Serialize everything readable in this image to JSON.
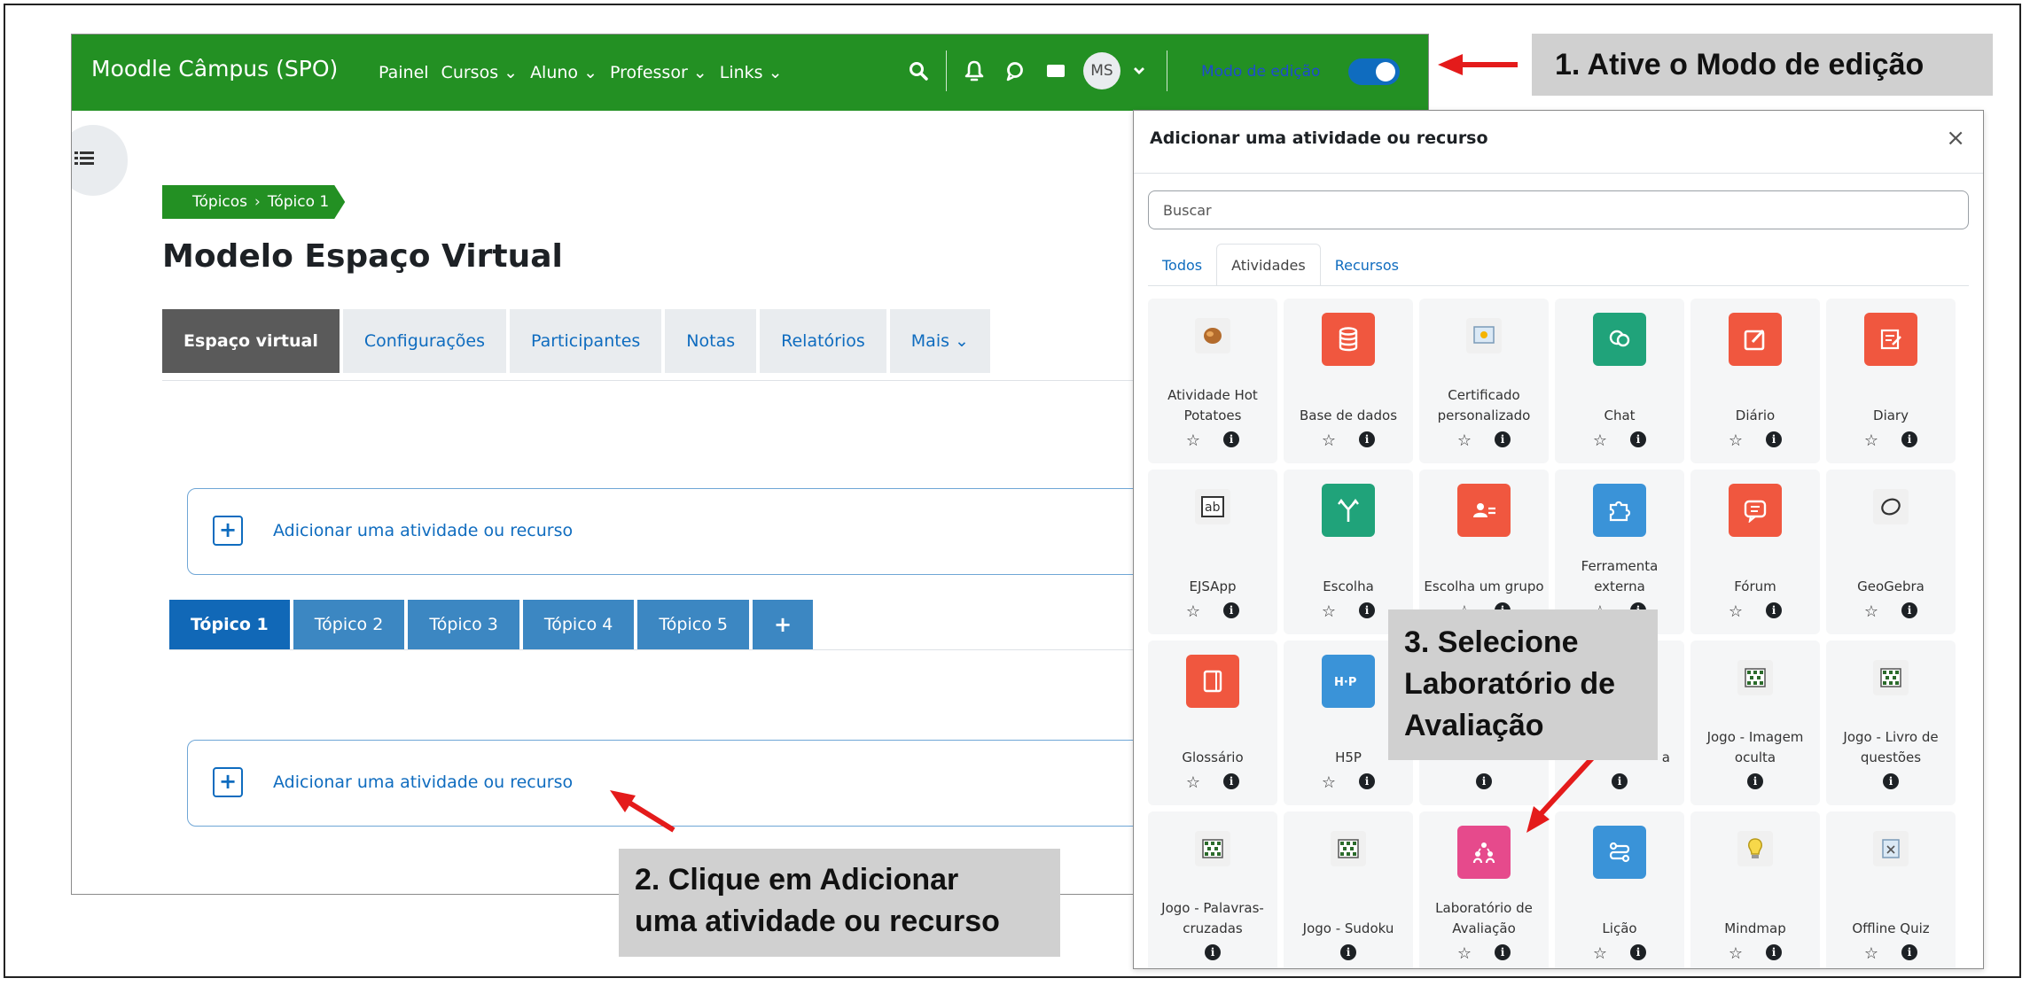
{
  "navbar": {
    "brand": "Moodle Câmpus (SPO)",
    "menu": [
      "Painel",
      "Cursos ⌄",
      "Aluno ⌄",
      "Professor ⌄",
      "Links ⌄"
    ],
    "avatar": "MS",
    "edit_mode_label": "Modo de edição",
    "edit_mode_on": true
  },
  "breadcrumb": {
    "root": "Tópicos",
    "current": "Tópico 1"
  },
  "page_title": "Modelo Espaço Virtual",
  "course_tabs": [
    {
      "label": "Espaço virtual",
      "active": true
    },
    {
      "label": "Configurações",
      "active": false
    },
    {
      "label": "Participantes",
      "active": false
    },
    {
      "label": "Notas",
      "active": false
    },
    {
      "label": "Relatórios",
      "active": false
    },
    {
      "label": "Mais ⌄",
      "active": false
    }
  ],
  "add_activity_label": "Adicionar uma atividade ou recurso",
  "topic_tabs": [
    "Tópico 1",
    "Tópico 2",
    "Tópico 3",
    "Tópico 4",
    "Tópico 5",
    "+"
  ],
  "modal": {
    "title": "Adicionar uma atividade ou recurso",
    "close": "×",
    "search_placeholder": "Buscar",
    "tabs": [
      {
        "label": "Todos",
        "active": false
      },
      {
        "label": "Atividades",
        "active": true
      },
      {
        "label": "Recursos",
        "active": false
      }
    ],
    "items": [
      {
        "name": "Atividade Hot Potatoes",
        "icon": "hot-potatoes-icon",
        "color": "#f0f0f0",
        "star": true,
        "info": true
      },
      {
        "name": "Base de dados",
        "icon": "database-icon",
        "color": "#f0573f",
        "star": true,
        "info": true
      },
      {
        "name": "Certificado personalizado",
        "icon": "certificate-icon",
        "color": "#f0f0f0",
        "star": true,
        "info": true
      },
      {
        "name": "Chat",
        "icon": "chat-icon",
        "color": "#20a37a",
        "star": true,
        "info": true
      },
      {
        "name": "Diário",
        "icon": "journal-icon",
        "color": "#f0573f",
        "star": true,
        "info": true
      },
      {
        "name": "Diary",
        "icon": "diary-icon",
        "color": "#f0573f",
        "star": true,
        "info": true
      },
      {
        "name": "EJSApp",
        "icon": "ejsapp-lab-icon",
        "color": "#f0f0f0",
        "star": true,
        "info": true
      },
      {
        "name": "Escolha",
        "icon": "choice-icon",
        "color": "#20a37a",
        "star": true,
        "info": true
      },
      {
        "name": "Escolha um grupo",
        "icon": "group-choice-icon",
        "color": "#f0573f",
        "star": true,
        "info": true
      },
      {
        "name": "Ferramenta externa",
        "icon": "external-tool-icon",
        "color": "#3a93d8",
        "star": true,
        "info": true
      },
      {
        "name": "Fórum",
        "icon": "forum-icon",
        "color": "#f0573f",
        "star": true,
        "info": true
      },
      {
        "name": "GeoGebra",
        "icon": "geogebra-icon",
        "color": "#f0f0f0",
        "star": true,
        "info": true
      },
      {
        "name": "Glossário",
        "icon": "glossary-icon",
        "color": "#f0573f",
        "star": true,
        "info": true
      },
      {
        "name": "H5P",
        "icon": "h5p-icon",
        "color": "#3a93d8",
        "star": true,
        "info": true
      },
      {
        "name": "",
        "icon": "hidden-icon",
        "color": "#f5f6f7",
        "star": false,
        "info": true
      },
      {
        "name": "a",
        "icon": "hidden-icon",
        "color": "#f5f6f7",
        "star": false,
        "info": true
      },
      {
        "name": "Jogo - Imagem oculta",
        "icon": "game-icon",
        "color": "#f0f0f0",
        "star": false,
        "info": true
      },
      {
        "name": "Jogo - Livro de questões",
        "icon": "game-icon",
        "color": "#f0f0f0",
        "star": false,
        "info": true
      },
      {
        "name": "Jogo - Palavras-cruzadas",
        "icon": "game-icon",
        "color": "#f0f0f0",
        "star": false,
        "info": true
      },
      {
        "name": "Jogo - Sudoku",
        "icon": "game-icon",
        "color": "#f0f0f0",
        "star": false,
        "info": true
      },
      {
        "name": "Laboratório de Avaliação",
        "icon": "workshop-icon",
        "color": "#e64a8c",
        "star": true,
        "info": true
      },
      {
        "name": "Lição",
        "icon": "lesson-icon",
        "color": "#3a93d8",
        "star": true,
        "info": true
      },
      {
        "name": "Mindmap",
        "icon": "mindmap-icon",
        "color": "#f0f0f0",
        "star": true,
        "info": true
      },
      {
        "name": "Offline Quiz",
        "icon": "offline-quiz-icon",
        "color": "#f0f0f0",
        "star": true,
        "info": true
      }
    ]
  },
  "callouts": {
    "step1": "1. Ative o Modo de edição",
    "step2_line1": "2. Clique em Adicionar",
    "step2_line2": "uma atividade ou recurso",
    "step3_line1": "3. Selecione",
    "step3_line2": "Laboratório de",
    "step3_line3": "Avaliação"
  },
  "colors": {
    "navbar": "#239023",
    "primary": "#0f6cbf",
    "annotation_arrow": "#e41b1b",
    "callout_bg": "#d0d0d0"
  }
}
